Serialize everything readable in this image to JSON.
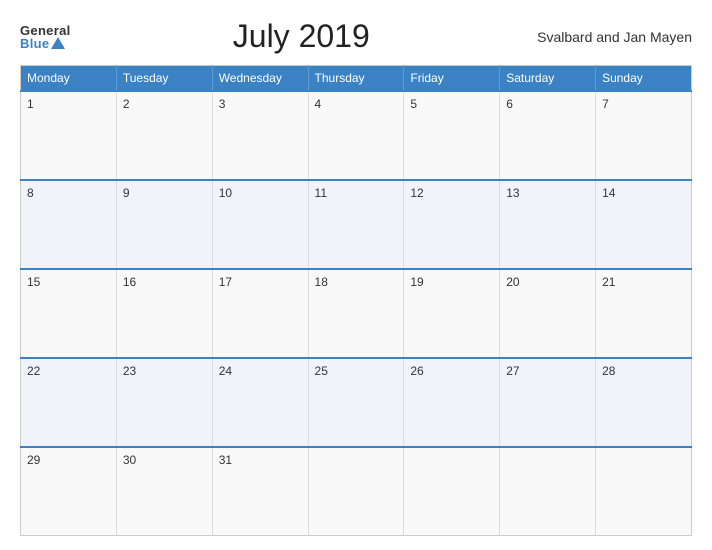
{
  "header": {
    "logo_general": "General",
    "logo_blue": "Blue",
    "title": "July 2019",
    "region": "Svalbard and Jan Mayen"
  },
  "calendar": {
    "days_of_week": [
      "Monday",
      "Tuesday",
      "Wednesday",
      "Thursday",
      "Friday",
      "Saturday",
      "Sunday"
    ],
    "weeks": [
      [
        {
          "num": "1",
          "empty": false
        },
        {
          "num": "2",
          "empty": false
        },
        {
          "num": "3",
          "empty": false
        },
        {
          "num": "4",
          "empty": false
        },
        {
          "num": "5",
          "empty": false
        },
        {
          "num": "6",
          "empty": false
        },
        {
          "num": "7",
          "empty": false
        }
      ],
      [
        {
          "num": "8",
          "empty": false
        },
        {
          "num": "9",
          "empty": false
        },
        {
          "num": "10",
          "empty": false
        },
        {
          "num": "11",
          "empty": false
        },
        {
          "num": "12",
          "empty": false
        },
        {
          "num": "13",
          "empty": false
        },
        {
          "num": "14",
          "empty": false
        }
      ],
      [
        {
          "num": "15",
          "empty": false
        },
        {
          "num": "16",
          "empty": false
        },
        {
          "num": "17",
          "empty": false
        },
        {
          "num": "18",
          "empty": false
        },
        {
          "num": "19",
          "empty": false
        },
        {
          "num": "20",
          "empty": false
        },
        {
          "num": "21",
          "empty": false
        }
      ],
      [
        {
          "num": "22",
          "empty": false
        },
        {
          "num": "23",
          "empty": false
        },
        {
          "num": "24",
          "empty": false
        },
        {
          "num": "25",
          "empty": false
        },
        {
          "num": "26",
          "empty": false
        },
        {
          "num": "27",
          "empty": false
        },
        {
          "num": "28",
          "empty": false
        }
      ],
      [
        {
          "num": "29",
          "empty": false
        },
        {
          "num": "30",
          "empty": false
        },
        {
          "num": "31",
          "empty": false
        },
        {
          "num": "",
          "empty": true
        },
        {
          "num": "",
          "empty": true
        },
        {
          "num": "",
          "empty": true
        },
        {
          "num": "",
          "empty": true
        }
      ]
    ]
  }
}
